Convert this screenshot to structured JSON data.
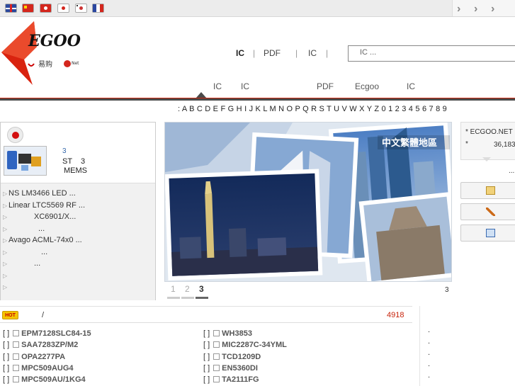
{
  "topbar": {
    "flags": [
      "uk-flag-icon",
      "china-flag-icon",
      "hongkong-flag-icon",
      "japan-flag-icon",
      "korea-flag-icon",
      "france-flag-icon"
    ],
    "nav_arrows": [
      "›",
      "›",
      "›"
    ]
  },
  "header": {
    "logo_text": "EGOO",
    "logo_sub": "易购",
    "logo_net": "Net",
    "topnav": [
      {
        "label": "IC"
      },
      {
        "label": "|"
      },
      {
        "label": "PDF"
      },
      {
        "label": "|"
      },
      {
        "label": "IC"
      },
      {
        "label": "|"
      }
    ],
    "search_placeholder": "IC ..."
  },
  "subnav": [
    "IC",
    "IC",
    "PDF",
    "Ecgoo",
    "IC"
  ],
  "alphabet": ": A B C D E F G H I J K L M N O P Q R S T U V W X Y Z 0 1 2 3 4 5 6 7 8 9",
  "left": {
    "news_number": "3",
    "news_line1": "ST",
    "news_line1_num": "3",
    "news_line2": "MEMS",
    "list": [
      "NS  LM3466  LED   ...",
      "Linear  LTC5569  RF   ...",
      "XC6901/X...",
      "...",
      "Avago  ACML-74x0      ...",
      "...",
      "...",
      "",
      ""
    ]
  },
  "banner": {
    "caption": "中文繁體地區",
    "pages": [
      "1",
      "2",
      "3"
    ],
    "active_page": "3",
    "right_number": "3"
  },
  "right": {
    "line1": "* ECGOO.NET",
    "line2": "*",
    "line2_num": "36,183",
    "more": "...",
    "buttons": [
      "edit-icon",
      "wrench-icon",
      "contact-icon"
    ]
  },
  "parts": {
    "hot_badge": "HOT",
    "header_sep": "/",
    "count": "4918",
    "bracket": "[ ]",
    "col1": [
      "EPM7128SLC84-15",
      "SAA7283ZP/M2",
      "OPA2277PA",
      "MPC509AUG4",
      "MPC509AU/1KG4"
    ],
    "col2": [
      "WH3853",
      "MIC2287C-34YML",
      "TCD1209D",
      "EN5360DI",
      "TA2111FG"
    ]
  },
  "rightlist": {
    "dots": [
      ".",
      ".",
      ".",
      ".",
      "."
    ]
  },
  "colors": {
    "accent_red": "#c8240c",
    "count_red": "#c8240c",
    "badge_yellow": "#f5c400",
    "link_blue": "#3366aa"
  }
}
